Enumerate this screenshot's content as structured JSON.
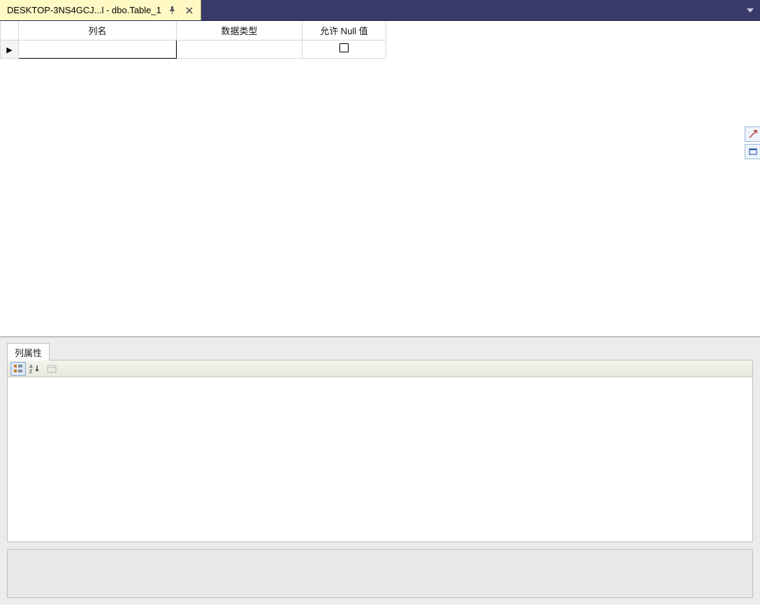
{
  "tab": {
    "title": "DESKTOP-3NS4GCJ...l - dbo.Table_1"
  },
  "grid": {
    "headers": {
      "column_name": "列名",
      "data_type": "数据类型",
      "allow_null": "允许 Null 值"
    },
    "row": {
      "column_name": "",
      "data_type": "",
      "allow_null_checked": false
    }
  },
  "properties_pane": {
    "tab_label": "列属性",
    "toolbar": {
      "categorized": "categorized-icon",
      "alphabetical": "alphabetical-icon",
      "property_pages": "property-pages-icon"
    }
  }
}
